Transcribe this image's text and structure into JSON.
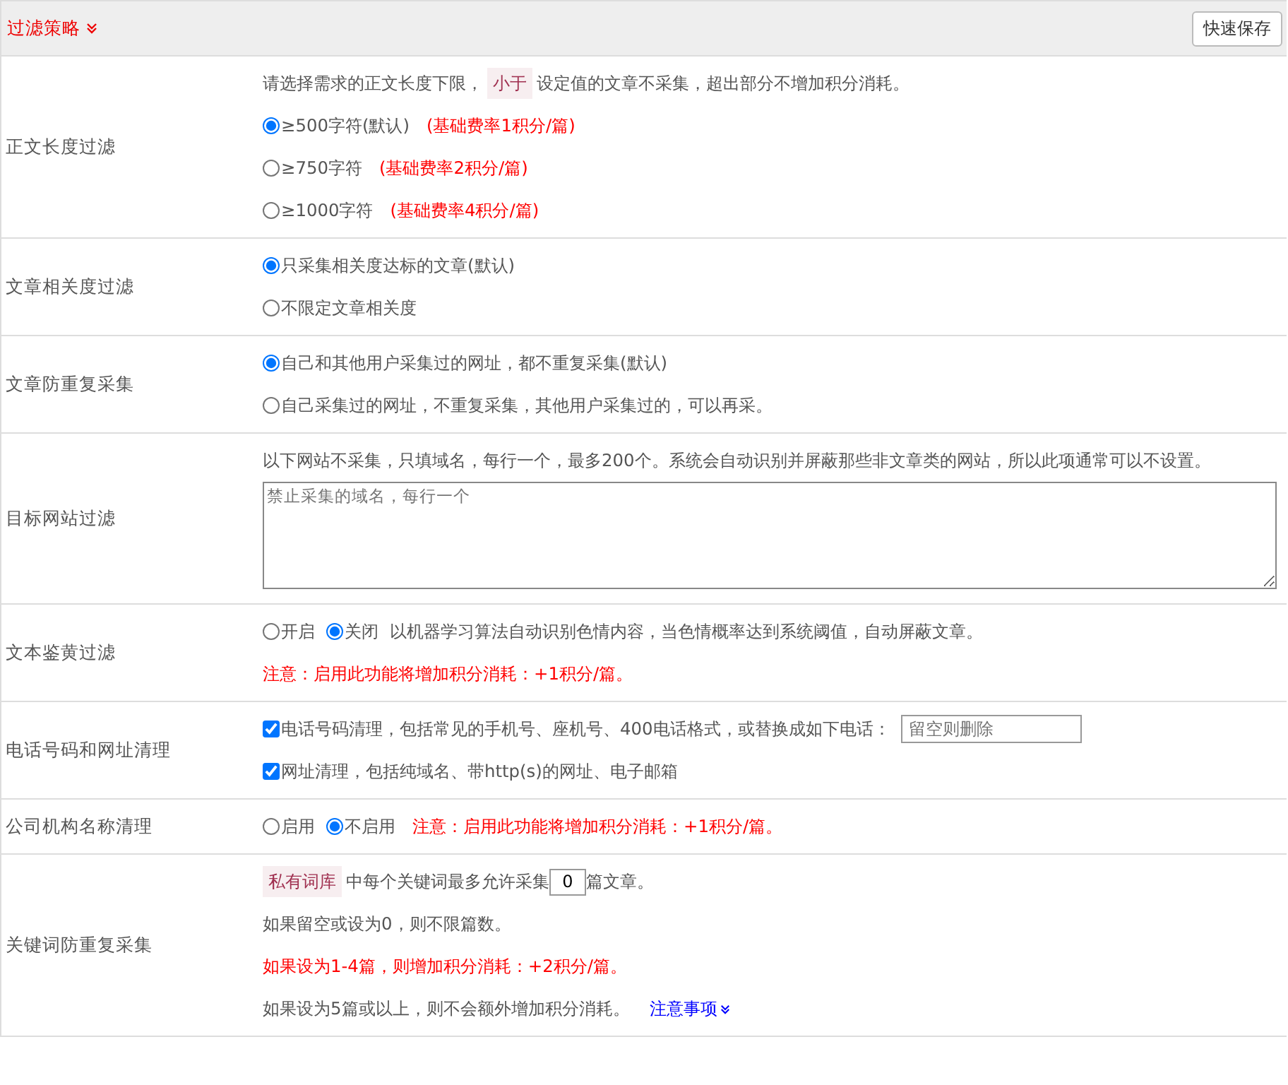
{
  "header": {
    "title": "过滤策略",
    "save_button": "快速保存"
  },
  "rows": [
    {
      "label": "正文长度过滤",
      "lines": [
        [
          {
            "kind": "text",
            "text": "请选择需求的正文长度下限，"
          },
          {
            "kind": "tag",
            "text": "小于"
          },
          {
            "kind": "text",
            "text": "设定值的文章不采集，超出部分不增加积分消耗。"
          }
        ],
        [
          {
            "kind": "radio",
            "text": "≥500字符(默认)",
            "selected": true
          },
          {
            "kind": "note",
            "text": "(基础费率1积分/篇)"
          }
        ],
        [
          {
            "kind": "radio",
            "text": "≥750字符",
            "selected": false
          },
          {
            "kind": "note",
            "text": "(基础费率2积分/篇)"
          }
        ],
        [
          {
            "kind": "radio",
            "text": "≥1000字符",
            "selected": false
          },
          {
            "kind": "note",
            "text": "(基础费率4积分/篇)"
          }
        ]
      ]
    },
    {
      "label": "文章相关度过滤",
      "lines": [
        [
          {
            "kind": "radio",
            "text": "只采集相关度达标的文章(默认)",
            "selected": true
          }
        ],
        [
          {
            "kind": "radio",
            "text": "不限定文章相关度",
            "selected": false
          }
        ]
      ]
    },
    {
      "label": "文章防重复采集",
      "lines": [
        [
          {
            "kind": "radio",
            "text": "自己和其他用户采集过的网址，都不重复采集(默认)",
            "selected": true
          }
        ],
        [
          {
            "kind": "radio",
            "text": "自己采集过的网址，不重复采集，其他用户采集过的，可以再采。",
            "selected": false
          }
        ]
      ]
    },
    {
      "label": "目标网站过滤",
      "lines": [
        [
          {
            "kind": "text",
            "text": "以下网站不采集，只填域名，每行一个，最多200个。系统会自动识别并屏蔽那些非文章类的网站，所以此项通常可以不设置。"
          }
        ],
        [
          {
            "kind": "textarea",
            "placeholder": "禁止采集的域名，每行一个"
          }
        ]
      ]
    },
    {
      "label": "文本鉴黄过滤",
      "lines": [
        [
          {
            "kind": "radio",
            "text": "开启",
            "selected": false
          },
          {
            "kind": "radio",
            "text": "关闭",
            "selected": true
          },
          {
            "kind": "text",
            "text": "以机器学习算法自动识别色情内容，当色情概率达到系统阈值，自动屏蔽文章。"
          }
        ],
        [
          {
            "kind": "note",
            "text": "注意：启用此功能将增加积分消耗：+1积分/篇。"
          }
        ]
      ]
    },
    {
      "label": "电话号码和网址清理",
      "lines": [
        [
          {
            "kind": "checkbox",
            "text": "电话号码清理，包括常见的手机号、座机号、400电话格式，或替换成如下电话：",
            "checked": true
          },
          {
            "kind": "input",
            "placeholder": "留空则删除"
          }
        ],
        [
          {
            "kind": "checkbox",
            "text": "网址清理，包括纯域名、带http(s)的网址、电子邮箱",
            "checked": true
          }
        ]
      ]
    },
    {
      "label": "公司机构名称清理",
      "lines": [
        [
          {
            "kind": "radio",
            "text": "启用",
            "selected": false
          },
          {
            "kind": "radio",
            "text": "不启用",
            "selected": true
          },
          {
            "kind": "note",
            "text": "注意：启用此功能将增加积分消耗：+1积分/篇。"
          }
        ]
      ]
    },
    {
      "label": "关键词防重复采集",
      "lines": [
        [
          {
            "kind": "tag",
            "text": "私有词库"
          },
          {
            "kind": "text",
            "text": "中每个关键词最多允许采集"
          },
          {
            "kind": "number",
            "value": "0"
          },
          {
            "kind": "text",
            "text": "篇文章。"
          }
        ],
        [
          {
            "kind": "text",
            "text": "如果留空或设为0，则不限篇数。"
          }
        ],
        [
          {
            "kind": "note",
            "text": "如果设为1-4篇，则增加积分消耗：+2积分/篇。"
          }
        ],
        [
          {
            "kind": "text",
            "text": "如果设为5篇或以上，则不会额外增加积分消耗。"
          },
          {
            "kind": "link",
            "text": "注意事项"
          }
        ]
      ]
    }
  ]
}
